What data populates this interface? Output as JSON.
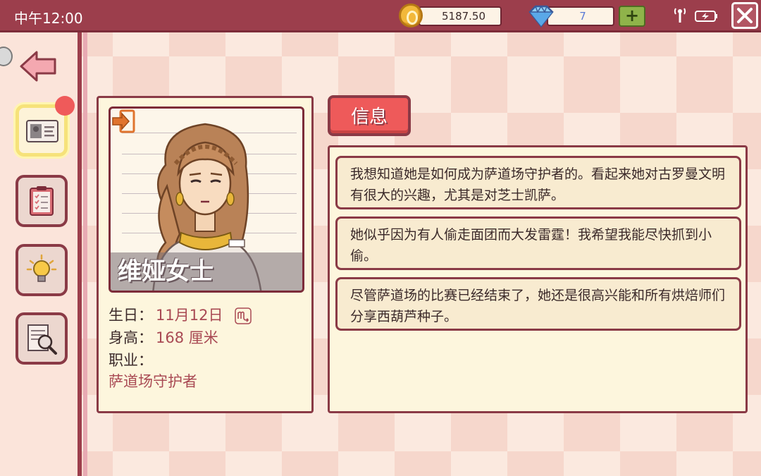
{
  "status_bar": {
    "time": "中午12:00",
    "money": "5187.50",
    "gems": "7",
    "add_label": "+"
  },
  "sidebar": {
    "items": [
      {
        "name": "id-card",
        "icon": "id-card-icon",
        "active": true
      },
      {
        "name": "clipboard",
        "icon": "clipboard-icon",
        "active": false
      },
      {
        "name": "idea",
        "icon": "lightbulb-icon",
        "active": false
      },
      {
        "name": "inspect",
        "icon": "magnifier-note-icon",
        "active": false
      }
    ]
  },
  "profile": {
    "name": "维娅女士",
    "birthday_label": "生日：",
    "birthday_value": "11月12日",
    "zodiac_icon": "scorpio-icon",
    "height_label": "身高：",
    "height_value": "168 厘米",
    "occupation_label": "职业：",
    "occupation_value": "萨道场守护者"
  },
  "tab": {
    "label": "信息"
  },
  "notes": [
    "我想知道她是如何成为萨道场守护者的。看起来她对古罗曼文明有很大的兴趣，尤其是对芝士凯萨。",
    "她似乎因为有人偷走面团而大发雷霆！我希望我能尽快抓到小偷。",
    "尽管萨道场的比赛已经结束了，她还是很高兴能和所有烘焙师们分享西葫芦种子。"
  ],
  "colors": {
    "accent": "#9c3e4c",
    "tab": "#ee5a5a",
    "panel": "#fdf6dd",
    "highlight_text": "#a94a54"
  }
}
